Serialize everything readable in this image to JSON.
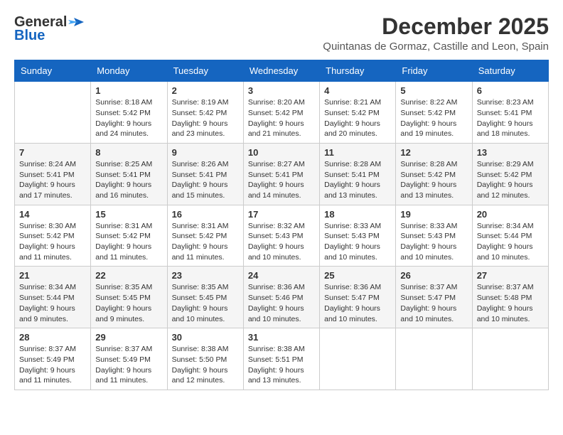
{
  "logo": {
    "general": "General",
    "blue": "Blue",
    "icon": "▶"
  },
  "title": "December 2025",
  "subtitle": "Quintanas de Gormaz, Castille and Leon, Spain",
  "calendar": {
    "headers": [
      "Sunday",
      "Monday",
      "Tuesday",
      "Wednesday",
      "Thursday",
      "Friday",
      "Saturday"
    ],
    "weeks": [
      [
        {
          "day": "",
          "sunrise": "",
          "sunset": "",
          "daylight": ""
        },
        {
          "day": "1",
          "sunrise": "Sunrise: 8:18 AM",
          "sunset": "Sunset: 5:42 PM",
          "daylight": "Daylight: 9 hours and 24 minutes."
        },
        {
          "day": "2",
          "sunrise": "Sunrise: 8:19 AM",
          "sunset": "Sunset: 5:42 PM",
          "daylight": "Daylight: 9 hours and 23 minutes."
        },
        {
          "day": "3",
          "sunrise": "Sunrise: 8:20 AM",
          "sunset": "Sunset: 5:42 PM",
          "daylight": "Daylight: 9 hours and 21 minutes."
        },
        {
          "day": "4",
          "sunrise": "Sunrise: 8:21 AM",
          "sunset": "Sunset: 5:42 PM",
          "daylight": "Daylight: 9 hours and 20 minutes."
        },
        {
          "day": "5",
          "sunrise": "Sunrise: 8:22 AM",
          "sunset": "Sunset: 5:42 PM",
          "daylight": "Daylight: 9 hours and 19 minutes."
        },
        {
          "day": "6",
          "sunrise": "Sunrise: 8:23 AM",
          "sunset": "Sunset: 5:41 PM",
          "daylight": "Daylight: 9 hours and 18 minutes."
        }
      ],
      [
        {
          "day": "7",
          "sunrise": "Sunrise: 8:24 AM",
          "sunset": "Sunset: 5:41 PM",
          "daylight": "Daylight: 9 hours and 17 minutes."
        },
        {
          "day": "8",
          "sunrise": "Sunrise: 8:25 AM",
          "sunset": "Sunset: 5:41 PM",
          "daylight": "Daylight: 9 hours and 16 minutes."
        },
        {
          "day": "9",
          "sunrise": "Sunrise: 8:26 AM",
          "sunset": "Sunset: 5:41 PM",
          "daylight": "Daylight: 9 hours and 15 minutes."
        },
        {
          "day": "10",
          "sunrise": "Sunrise: 8:27 AM",
          "sunset": "Sunset: 5:41 PM",
          "daylight": "Daylight: 9 hours and 14 minutes."
        },
        {
          "day": "11",
          "sunrise": "Sunrise: 8:28 AM",
          "sunset": "Sunset: 5:41 PM",
          "daylight": "Daylight: 9 hours and 13 minutes."
        },
        {
          "day": "12",
          "sunrise": "Sunrise: 8:28 AM",
          "sunset": "Sunset: 5:42 PM",
          "daylight": "Daylight: 9 hours and 13 minutes."
        },
        {
          "day": "13",
          "sunrise": "Sunrise: 8:29 AM",
          "sunset": "Sunset: 5:42 PM",
          "daylight": "Daylight: 9 hours and 12 minutes."
        }
      ],
      [
        {
          "day": "14",
          "sunrise": "Sunrise: 8:30 AM",
          "sunset": "Sunset: 5:42 PM",
          "daylight": "Daylight: 9 hours and 11 minutes."
        },
        {
          "day": "15",
          "sunrise": "Sunrise: 8:31 AM",
          "sunset": "Sunset: 5:42 PM",
          "daylight": "Daylight: 9 hours and 11 minutes."
        },
        {
          "day": "16",
          "sunrise": "Sunrise: 8:31 AM",
          "sunset": "Sunset: 5:42 PM",
          "daylight": "Daylight: 9 hours and 11 minutes."
        },
        {
          "day": "17",
          "sunrise": "Sunrise: 8:32 AM",
          "sunset": "Sunset: 5:43 PM",
          "daylight": "Daylight: 9 hours and 10 minutes."
        },
        {
          "day": "18",
          "sunrise": "Sunrise: 8:33 AM",
          "sunset": "Sunset: 5:43 PM",
          "daylight": "Daylight: 9 hours and 10 minutes."
        },
        {
          "day": "19",
          "sunrise": "Sunrise: 8:33 AM",
          "sunset": "Sunset: 5:43 PM",
          "daylight": "Daylight: 9 hours and 10 minutes."
        },
        {
          "day": "20",
          "sunrise": "Sunrise: 8:34 AM",
          "sunset": "Sunset: 5:44 PM",
          "daylight": "Daylight: 9 hours and 10 minutes."
        }
      ],
      [
        {
          "day": "21",
          "sunrise": "Sunrise: 8:34 AM",
          "sunset": "Sunset: 5:44 PM",
          "daylight": "Daylight: 9 hours and 9 minutes."
        },
        {
          "day": "22",
          "sunrise": "Sunrise: 8:35 AM",
          "sunset": "Sunset: 5:45 PM",
          "daylight": "Daylight: 9 hours and 9 minutes."
        },
        {
          "day": "23",
          "sunrise": "Sunrise: 8:35 AM",
          "sunset": "Sunset: 5:45 PM",
          "daylight": "Daylight: 9 hours and 10 minutes."
        },
        {
          "day": "24",
          "sunrise": "Sunrise: 8:36 AM",
          "sunset": "Sunset: 5:46 PM",
          "daylight": "Daylight: 9 hours and 10 minutes."
        },
        {
          "day": "25",
          "sunrise": "Sunrise: 8:36 AM",
          "sunset": "Sunset: 5:47 PM",
          "daylight": "Daylight: 9 hours and 10 minutes."
        },
        {
          "day": "26",
          "sunrise": "Sunrise: 8:37 AM",
          "sunset": "Sunset: 5:47 PM",
          "daylight": "Daylight: 9 hours and 10 minutes."
        },
        {
          "day": "27",
          "sunrise": "Sunrise: 8:37 AM",
          "sunset": "Sunset: 5:48 PM",
          "daylight": "Daylight: 9 hours and 10 minutes."
        }
      ],
      [
        {
          "day": "28",
          "sunrise": "Sunrise: 8:37 AM",
          "sunset": "Sunset: 5:49 PM",
          "daylight": "Daylight: 9 hours and 11 minutes."
        },
        {
          "day": "29",
          "sunrise": "Sunrise: 8:37 AM",
          "sunset": "Sunset: 5:49 PM",
          "daylight": "Daylight: 9 hours and 11 minutes."
        },
        {
          "day": "30",
          "sunrise": "Sunrise: 8:38 AM",
          "sunset": "Sunset: 5:50 PM",
          "daylight": "Daylight: 9 hours and 12 minutes."
        },
        {
          "day": "31",
          "sunrise": "Sunrise: 8:38 AM",
          "sunset": "Sunset: 5:51 PM",
          "daylight": "Daylight: 9 hours and 13 minutes."
        },
        {
          "day": "",
          "sunrise": "",
          "sunset": "",
          "daylight": ""
        },
        {
          "day": "",
          "sunrise": "",
          "sunset": "",
          "daylight": ""
        },
        {
          "day": "",
          "sunrise": "",
          "sunset": "",
          "daylight": ""
        }
      ]
    ]
  }
}
